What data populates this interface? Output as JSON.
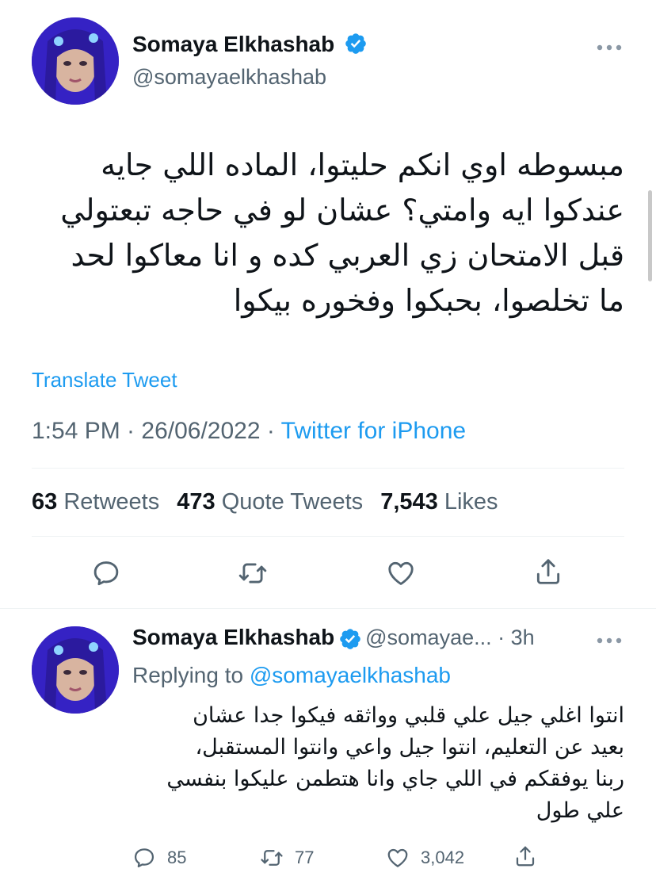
{
  "main_tweet": {
    "author_name": "Somaya Elkhashab",
    "handle": "@somayaelkhashab",
    "text_lines": [
      "مبسوطه اوي انكم حليتوا، الماده اللي جايه",
      "عندكوا ايه وامتي؟ عشان لو في حاجه تبعتولي",
      "قبل الامتحان زي العربي كده و انا معاكوا لحد",
      "ما تخلصوا، بحبكوا وفخوره بيكوا"
    ],
    "translate_label": "Translate Tweet",
    "time": "1:54 PM · 26/06/2022 · ",
    "source": "Twitter for iPhone",
    "stats": {
      "retweets_count": "63",
      "retweets_label": "Retweets",
      "quotes_count": "473",
      "quotes_label": "Quote Tweets",
      "likes_count": "7,543",
      "likes_label": "Likes"
    }
  },
  "reply_tweet": {
    "author_name": "Somaya Elkhashab",
    "handle_time": "@somayae... · 3h",
    "replying_prefix": "Replying to ",
    "replying_to": "@somayaelkhashab",
    "text_lines": [
      "انتوا اغلي جيل علي قلبي وواثقه فيكوا جدا عشان",
      "بعيد عن التعليم، انتوا جيل واعي وانتوا المستقبل،",
      "ربنا يوفقكم في اللي جاي وانا هتطمن عليكوا بنفسي",
      "علي طول"
    ],
    "reply_count": "85",
    "retweet_count": "77",
    "like_count": "3,042"
  },
  "colors": {
    "accent": "#1d9bf0",
    "text": "#0f1419",
    "secondary": "#536471",
    "divider": "#eff3f4"
  },
  "icons": [
    "verified-badge-icon",
    "more-icon",
    "reply-icon",
    "retweet-icon",
    "like-icon",
    "share-icon"
  ]
}
